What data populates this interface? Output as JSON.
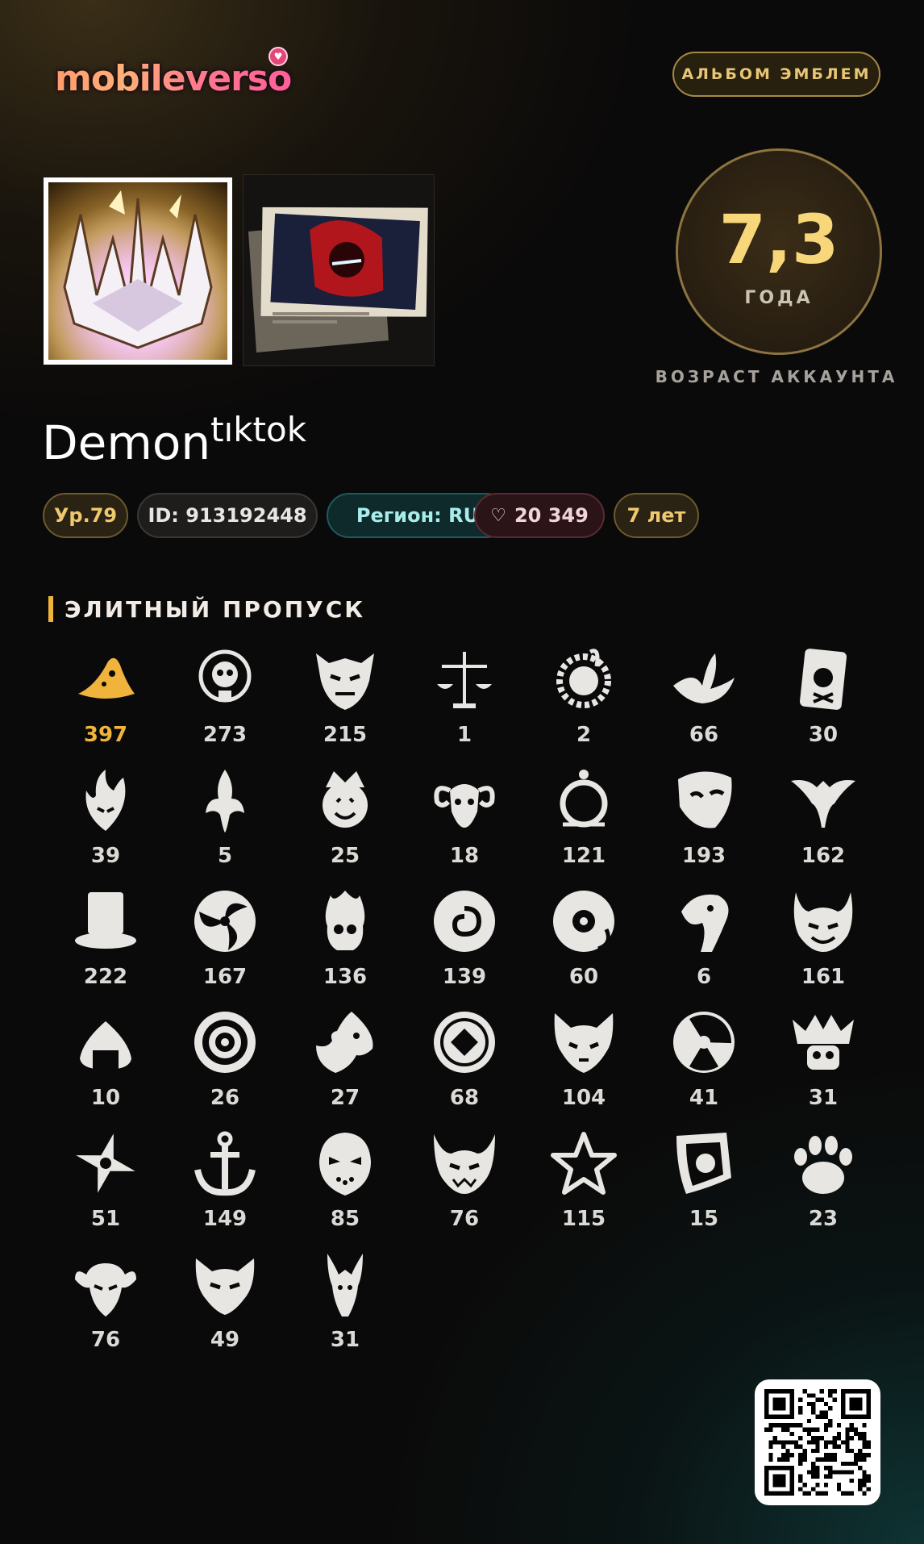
{
  "header": {
    "logo_text": "mobileverso",
    "album_button_label": "АЛЬБОМ ЭМБЛЕМ"
  },
  "profile": {
    "nickname": "Demon",
    "nickname_sup": "tıktok",
    "age_value": "7,3",
    "age_unit": "ГОДА",
    "age_caption": "ВОЗРАСТ АККАУНТА"
  },
  "chips": {
    "level": "Ур.79",
    "id": "ID: 913192448",
    "region": "Регион: RU",
    "likes": "20 349",
    "years": "7 лет"
  },
  "section": {
    "title": "ЭЛИТНЫЙ ПРОПУСК"
  },
  "emblems": [
    {
      "icon": "wizard-hat-icon",
      "count": "397",
      "highlight": true
    },
    {
      "icon": "skull-bulb-icon",
      "count": "273"
    },
    {
      "icon": "oni-mask-icon",
      "count": "215"
    },
    {
      "icon": "scales-icon",
      "count": "1"
    },
    {
      "icon": "rabbit-gear-icon",
      "count": "2"
    },
    {
      "icon": "crane-icon",
      "count": "66"
    },
    {
      "icon": "card-skull-icon",
      "count": "30"
    },
    {
      "icon": "flame-spirit-icon",
      "count": "39"
    },
    {
      "icon": "phoenix-icon",
      "count": "5"
    },
    {
      "icon": "jester-face-icon",
      "count": "25"
    },
    {
      "icon": "ram-skull-icon",
      "count": "18"
    },
    {
      "icon": "ornate-mirror-icon",
      "count": "121"
    },
    {
      "icon": "theater-mask-icon",
      "count": "193"
    },
    {
      "icon": "bat-wings-icon",
      "count": "162"
    },
    {
      "icon": "top-hat-icon",
      "count": "222"
    },
    {
      "icon": "tomoe-swirl-icon",
      "count": "167"
    },
    {
      "icon": "flaming-skull-icon",
      "count": "136"
    },
    {
      "icon": "cloud-swirl-icon",
      "count": "139"
    },
    {
      "icon": "vinyl-disc-icon",
      "count": "60"
    },
    {
      "icon": "eagle-head-icon",
      "count": "6"
    },
    {
      "icon": "devil-face-icon",
      "count": "161"
    },
    {
      "icon": "rice-ball-icon",
      "count": "10"
    },
    {
      "icon": "target-ring-icon",
      "count": "26"
    },
    {
      "icon": "wolf-head-icon",
      "count": "27"
    },
    {
      "icon": "coin-diamond-icon",
      "count": "68"
    },
    {
      "icon": "fox-head-icon",
      "count": "104"
    },
    {
      "icon": "radiation-icon",
      "count": "41"
    },
    {
      "icon": "crowned-skull-icon",
      "count": "31"
    },
    {
      "icon": "shuriken-icon",
      "count": "51"
    },
    {
      "icon": "anchor-icon",
      "count": "149"
    },
    {
      "icon": "hockey-mask-icon",
      "count": "85"
    },
    {
      "icon": "horned-demon-icon",
      "count": "76"
    },
    {
      "icon": "sheriff-star-icon",
      "count": "115"
    },
    {
      "icon": "shield-swirl-icon",
      "count": "15"
    },
    {
      "icon": "bear-paw-icon",
      "count": "23"
    },
    {
      "icon": "ram-horns-mask-icon",
      "count": "76"
    },
    {
      "icon": "beast-head-icon",
      "count": "49"
    },
    {
      "icon": "dragon-head-icon",
      "count": "31"
    }
  ]
}
